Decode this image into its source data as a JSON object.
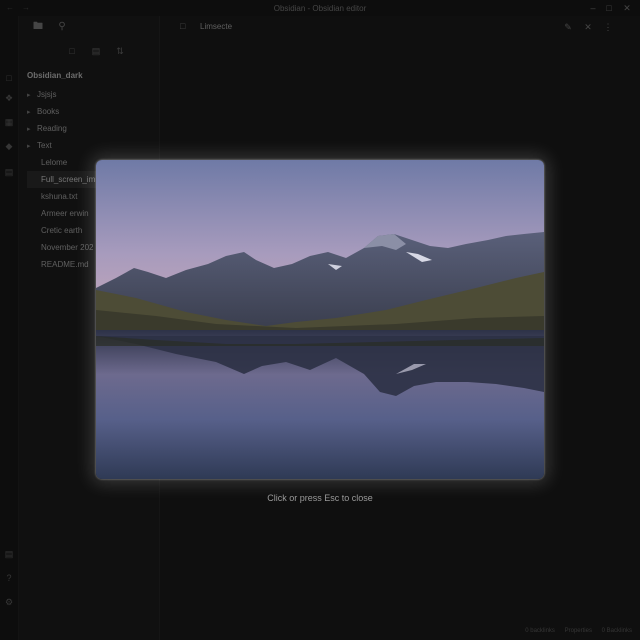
{
  "window": {
    "title": "Obsidian - Obsidian editor"
  },
  "ribbon": {
    "icons": [
      "files-icon",
      "graph-icon",
      "canvas-icon",
      "plugin-icon",
      "calendar-icon"
    ],
    "bottom_icons": [
      "vault-switcher-icon",
      "help-icon",
      "settings-icon"
    ]
  },
  "sidebar": {
    "vault_name": "Obsidian_dark",
    "tree": [
      {
        "label": "Jsjsjs",
        "type": "folder"
      },
      {
        "label": "Books",
        "type": "folder"
      },
      {
        "label": "Reading",
        "type": "folder"
      },
      {
        "label": "Text",
        "type": "folder"
      },
      {
        "label": "Lelome",
        "type": "file"
      },
      {
        "label": "Full_screen_im",
        "type": "file",
        "active": true
      },
      {
        "label": "kshuna.txt",
        "type": "file"
      },
      {
        "label": "Armeer erwin",
        "type": "file"
      },
      {
        "label": "Cretic earth",
        "type": "file"
      },
      {
        "label": "November 202",
        "type": "file"
      },
      {
        "label": "README.md",
        "type": "file"
      }
    ]
  },
  "editor": {
    "tab_title": "Limsecte"
  },
  "statusbar": {
    "backlinks": "0 backlinks",
    "properties": "Properties",
    "words": "0 Backlinks"
  },
  "overlay": {
    "close_hint": "Click or press Esc to close"
  },
  "colors": {
    "sky_top": "#6f7aa6",
    "sky_horizon": "#c9a8b8",
    "mountain": "#4a5064",
    "water": "#3d4560",
    "grass": "#5c5a3a"
  }
}
